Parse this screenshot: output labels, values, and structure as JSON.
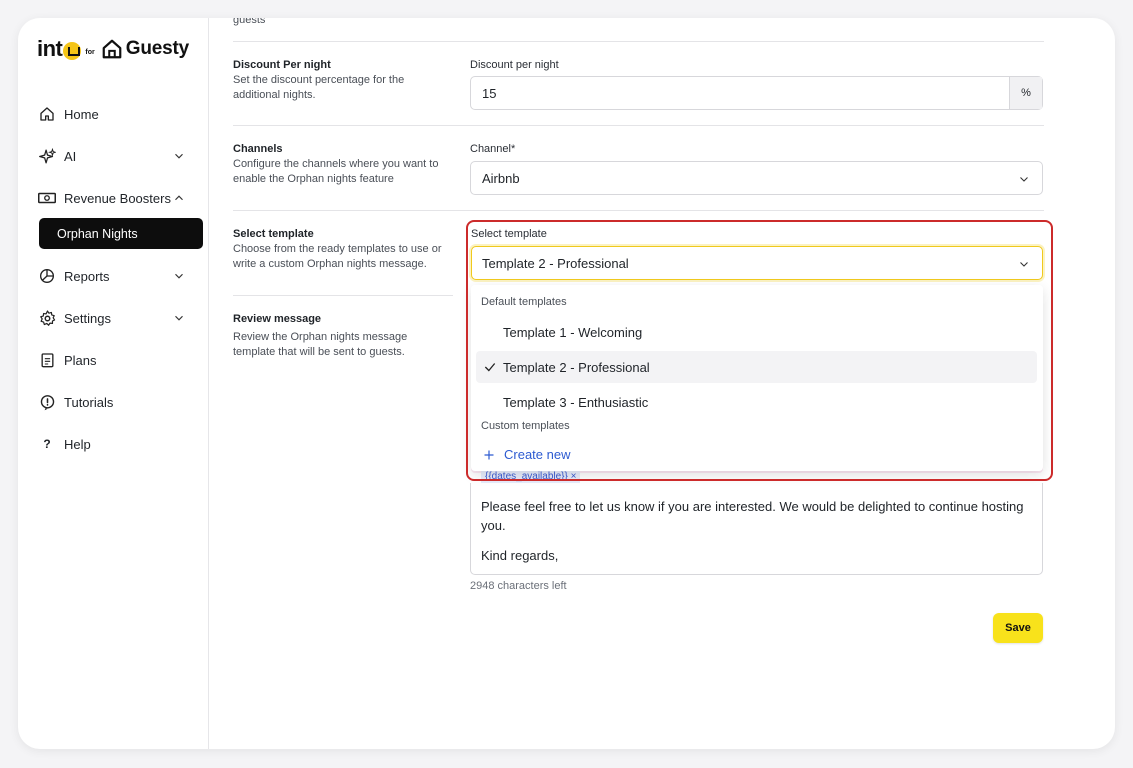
{
  "logo": {
    "int_text": "int",
    "for_text": "for",
    "brand_text": "Guesty"
  },
  "sidebar": {
    "items": [
      {
        "label": "Home",
        "icon": "home-icon"
      },
      {
        "label": "AI",
        "icon": "sparkle-icon"
      },
      {
        "label": "Revenue Boosters",
        "icon": "banknote-icon"
      },
      {
        "label": "Reports",
        "icon": "pie-chart-icon"
      },
      {
        "label": "Settings",
        "icon": "gear-icon"
      },
      {
        "label": "Plans",
        "icon": "clipboard-icon"
      },
      {
        "label": "Tutorials",
        "icon": "lightbulb-icon"
      },
      {
        "label": "Help",
        "icon": "question-icon"
      }
    ],
    "sub_item": "Orphan Nights"
  },
  "main": {
    "top_fragment": "guests",
    "discount": {
      "title": "Discount Per night",
      "description": "Set the discount percentage for the additional nights.",
      "field_label": "Discount per night",
      "value": "15",
      "suffix": "%"
    },
    "channels": {
      "title": "Channels",
      "description": "Configure the channels where you want to enable the Orphan nights feature",
      "field_label": "Channel*",
      "value": "Airbnb"
    },
    "template": {
      "title": "Select template",
      "description": "Choose from the ready templates to use or write a custom Orphan nights message.",
      "field_label": "Select template",
      "value": "Template 2 - Professional",
      "dropdown": {
        "default_group": "Default templates",
        "options": [
          "Template 1 - Welcoming",
          "Template 2 - Professional",
          "Template 3 - Enthusiastic"
        ],
        "custom_group": "Custom templates",
        "create_new": "Create new"
      }
    },
    "review": {
      "title": "Review message",
      "description": "Review the Orphan nights message template that will be sent to guests.",
      "token": "{{dates_available}} ×",
      "paragraphs": [
        "Please feel free to let us know if you are interested. We would be delighted to continue hosting you.",
        "Kind regards,"
      ],
      "chars_left": "2948 characters left"
    },
    "save_label": "Save"
  },
  "colors": {
    "accent_yellow": "#f8e21b",
    "highlight_red": "#cc2b2b",
    "link_blue": "#2d5bd1",
    "active_nav": "#0d0d0d"
  }
}
